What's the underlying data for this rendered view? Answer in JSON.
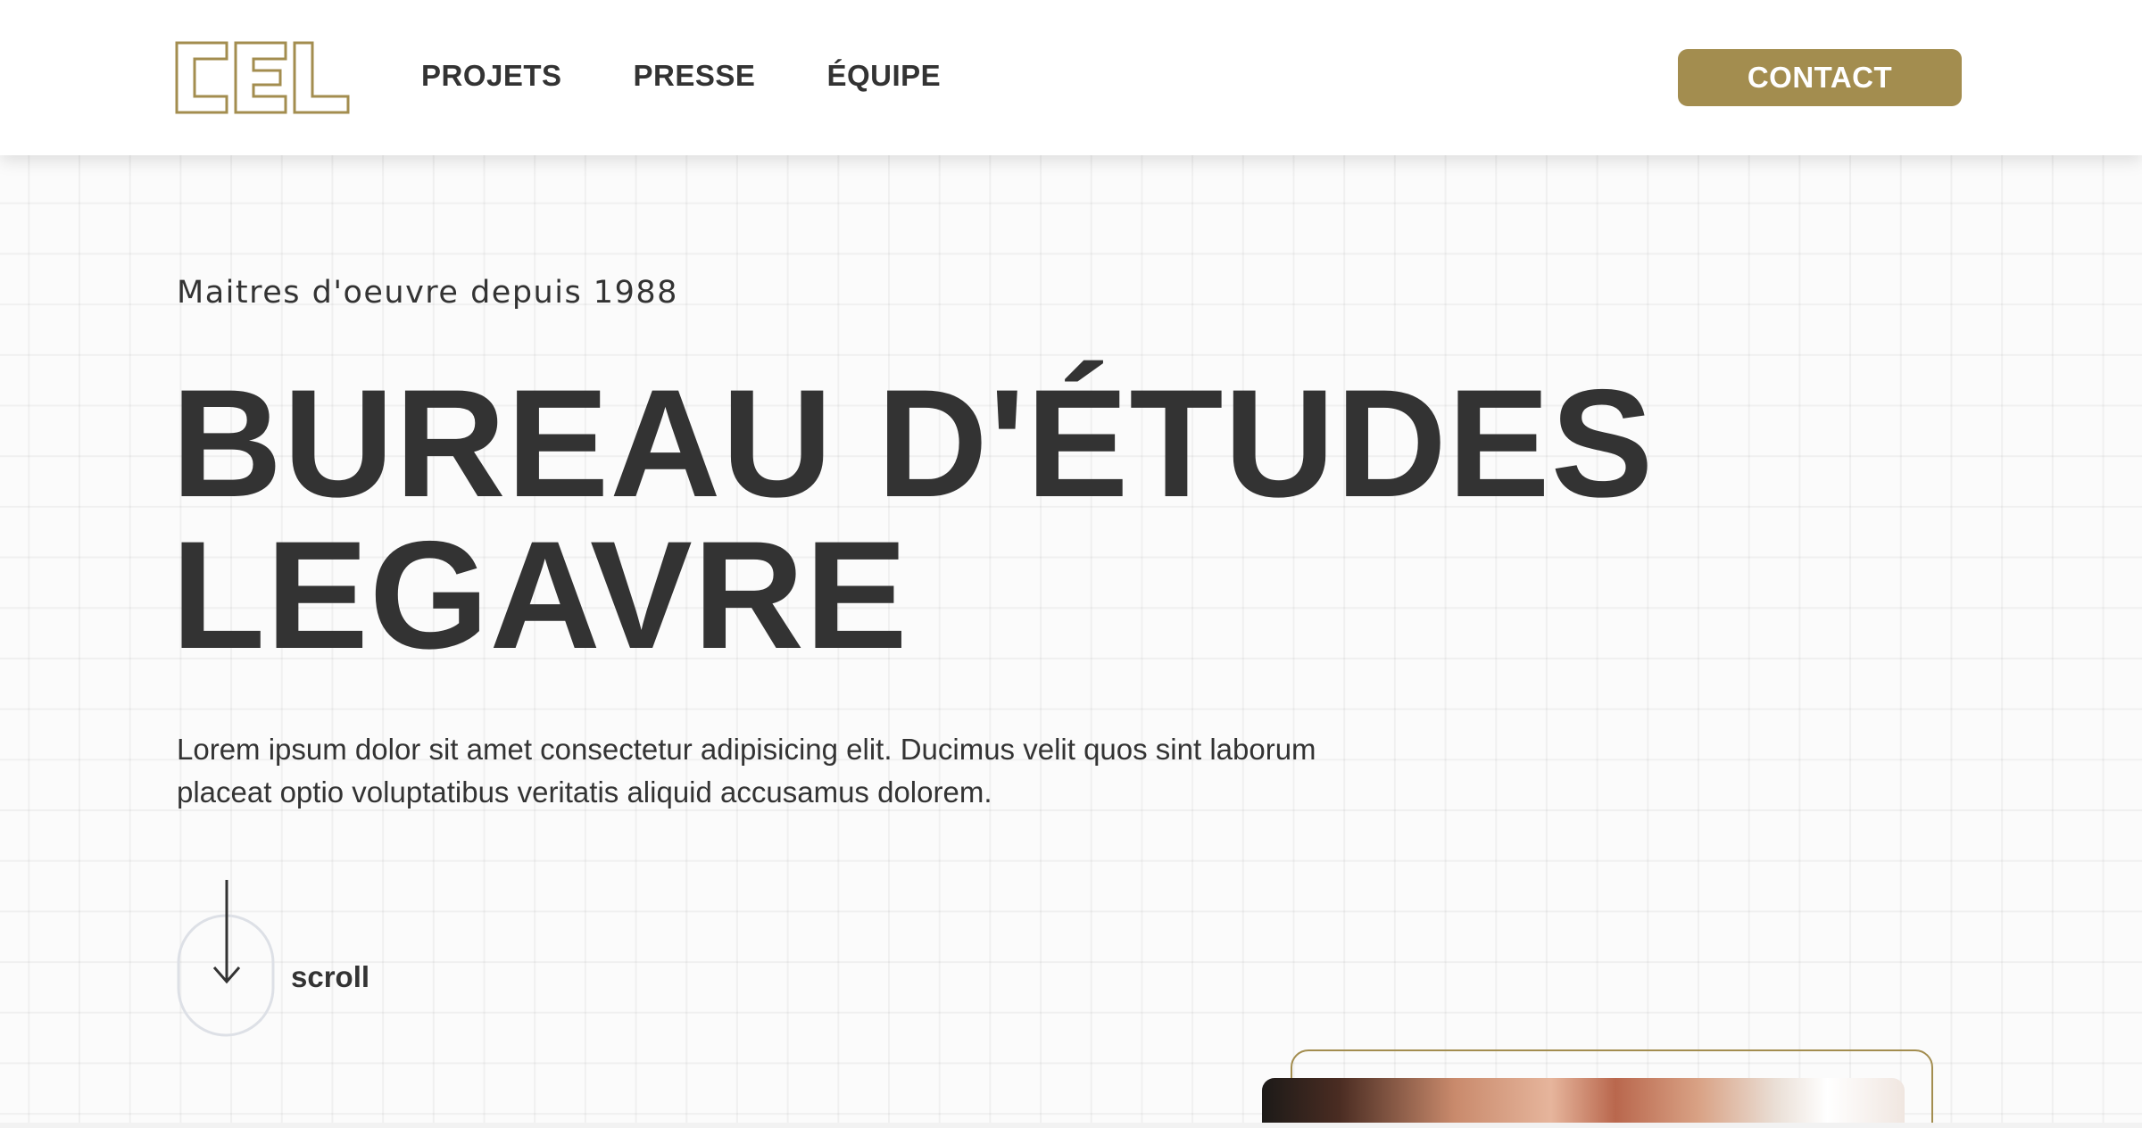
{
  "header": {
    "logo_name": "cel-logo",
    "nav": [
      {
        "label": "PROJETS"
      },
      {
        "label": "PRESSE"
      },
      {
        "label": "ÉQUIPE"
      }
    ],
    "contact_label": "CONTACT"
  },
  "hero": {
    "tagline": "Maitres d'oeuvre depuis 1988",
    "title_line1": "BUREAU D'ÉTUDES",
    "title_line2": "LEGAVRE",
    "lead_line1": "Lorem ipsum dolor sit amet consectetur adipisicing elit. Ducimus velit quos sint laborum",
    "lead_line2": "placeat optio voluptatibus veritatis aliquid accusamus dolorem.",
    "scroll_label": "scroll"
  },
  "colors": {
    "accent": "#a38d4f",
    "text": "#333333",
    "background": "#fbfbfb",
    "header_bg": "#ffffff"
  }
}
